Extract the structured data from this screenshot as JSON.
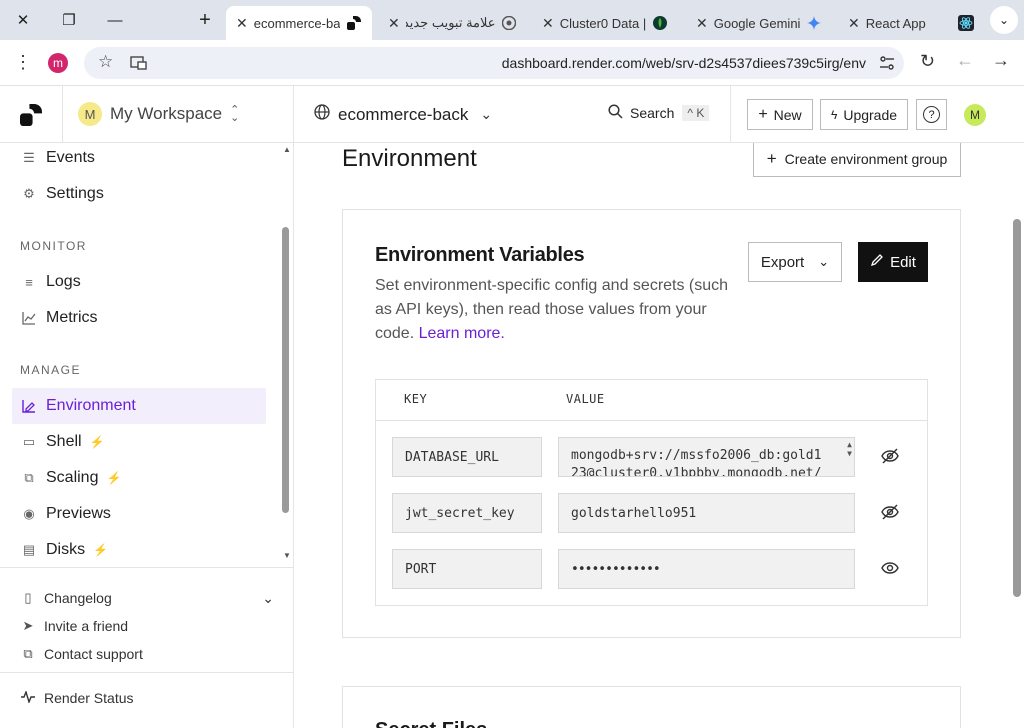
{
  "browser": {
    "tabs": [
      {
        "label": "ecommerce-ba",
        "active": true
      },
      {
        "label": "علامة تبويب جديدة"
      },
      {
        "label": "Cluster0 Data |"
      },
      {
        "label": "Google Gemini"
      },
      {
        "label": "React App"
      }
    ],
    "url": "dashboard.render.com/web/srv-d2s4537diees739c5irg/env",
    "profile_initial": "m"
  },
  "workspace": {
    "initial": "M",
    "name": "My Workspace"
  },
  "service": {
    "name": "ecommerce-back"
  },
  "header": {
    "search_label": "Search",
    "search_shortcut": "^ K",
    "new_label": "New",
    "upgrade_label": "Upgrade",
    "user_initial": "M"
  },
  "sidebar": {
    "items_top": [
      {
        "label": "Events"
      },
      {
        "label": "Settings"
      }
    ],
    "monitor_title": "MONITOR",
    "monitor_items": [
      {
        "label": "Logs"
      },
      {
        "label": "Metrics"
      }
    ],
    "manage_title": "MANAGE",
    "manage_items": [
      {
        "label": "Environment",
        "active": true
      },
      {
        "label": "Shell",
        "bolt": true
      },
      {
        "label": "Scaling",
        "bolt": true
      },
      {
        "label": "Previews"
      },
      {
        "label": "Disks",
        "bolt": true
      }
    ],
    "footer": [
      {
        "label": "Changelog"
      },
      {
        "label": "Invite a friend"
      },
      {
        "label": "Contact support"
      },
      {
        "label": "Render Status"
      }
    ]
  },
  "page": {
    "title": "Environment",
    "create_group_label": "Create environment group",
    "env_title": "Environment Variables",
    "env_desc": "Set environment-specific config and secrets (such as API keys), then read those values from your code.",
    "learn_more": "Learn more",
    "export_label": "Export",
    "edit_label": "Edit",
    "col_key": "KEY",
    "col_value": "VALUE",
    "rows": [
      {
        "key": "DATABASE_URL",
        "value_line1": "mongodb+srv://mssfo2006_db:gold1",
        "value_line2": "23@cluster0.v1bpbby.mongodb.net/"
      },
      {
        "key": "jwt_secret_key",
        "value_line1": "goldstarhello951"
      },
      {
        "key": "PORT",
        "value_line1": "•••••••••••••"
      }
    ],
    "next_card_title": "Secret Files"
  },
  "colors": {
    "accent": "#6b1fd6",
    "bolt": "#c421d8"
  }
}
